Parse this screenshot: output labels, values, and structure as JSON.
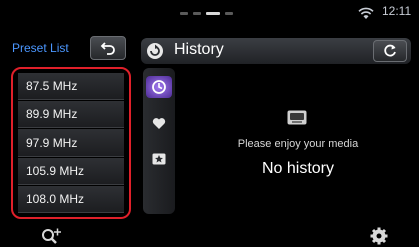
{
  "status_bar": {
    "clock": "12:11",
    "wifi_icon": "wifi-icon"
  },
  "preset": {
    "label": "Preset List",
    "items": [
      "87.5 MHz",
      "89.9 MHz",
      "97.9 MHz",
      "105.9 MHz",
      "108.0 MHz"
    ]
  },
  "history": {
    "title": "History",
    "media_icon": "youtube-icon",
    "message": "Please enjoy your media",
    "empty_text": "No history"
  },
  "tabs": [
    "history-tab",
    "favorite-tab",
    "star-tab"
  ],
  "colors": {
    "accent_blue": "#4b97ff",
    "highlight_red": "#e0202a",
    "tab_active": "#8a5ff0"
  }
}
